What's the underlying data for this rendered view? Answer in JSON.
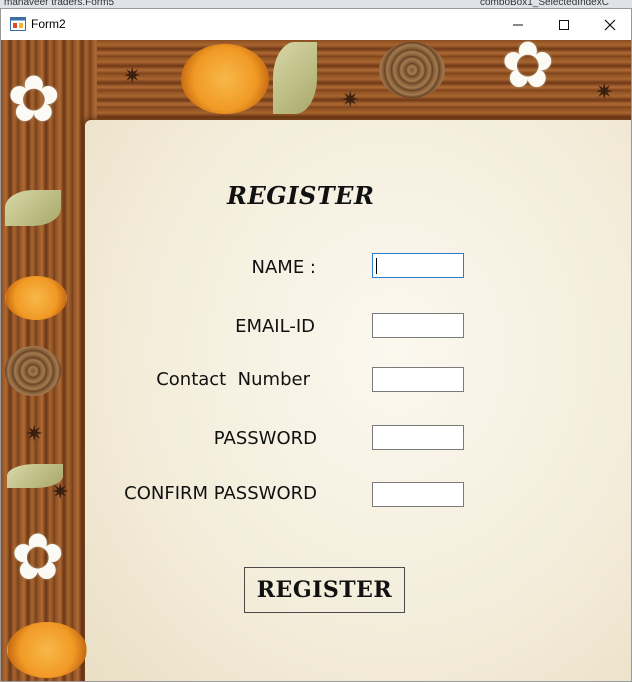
{
  "background_strip": {
    "left_text": "mahaveer traders.Form5",
    "right_text": "comboBox1_SelectedIndexC"
  },
  "window": {
    "title": "Form2",
    "controls": {
      "minimize": "—",
      "maximize": "☐",
      "close": "✕"
    }
  },
  "form": {
    "heading": "REGISTER",
    "fields": [
      {
        "label": "NAME :",
        "value": ""
      },
      {
        "label": "EMAIL-ID",
        "value": ""
      },
      {
        "label": "Contact  Number",
        "value": ""
      },
      {
        "label": "PASSWORD",
        "value": ""
      },
      {
        "label": "CONFIRM PASSWORD",
        "value": ""
      }
    ],
    "submit_label": "REGISTER"
  },
  "colors": {
    "frame_wood": "#8b4e22",
    "paper": "#f6f0e0",
    "focus_border": "#2a7bd3"
  }
}
